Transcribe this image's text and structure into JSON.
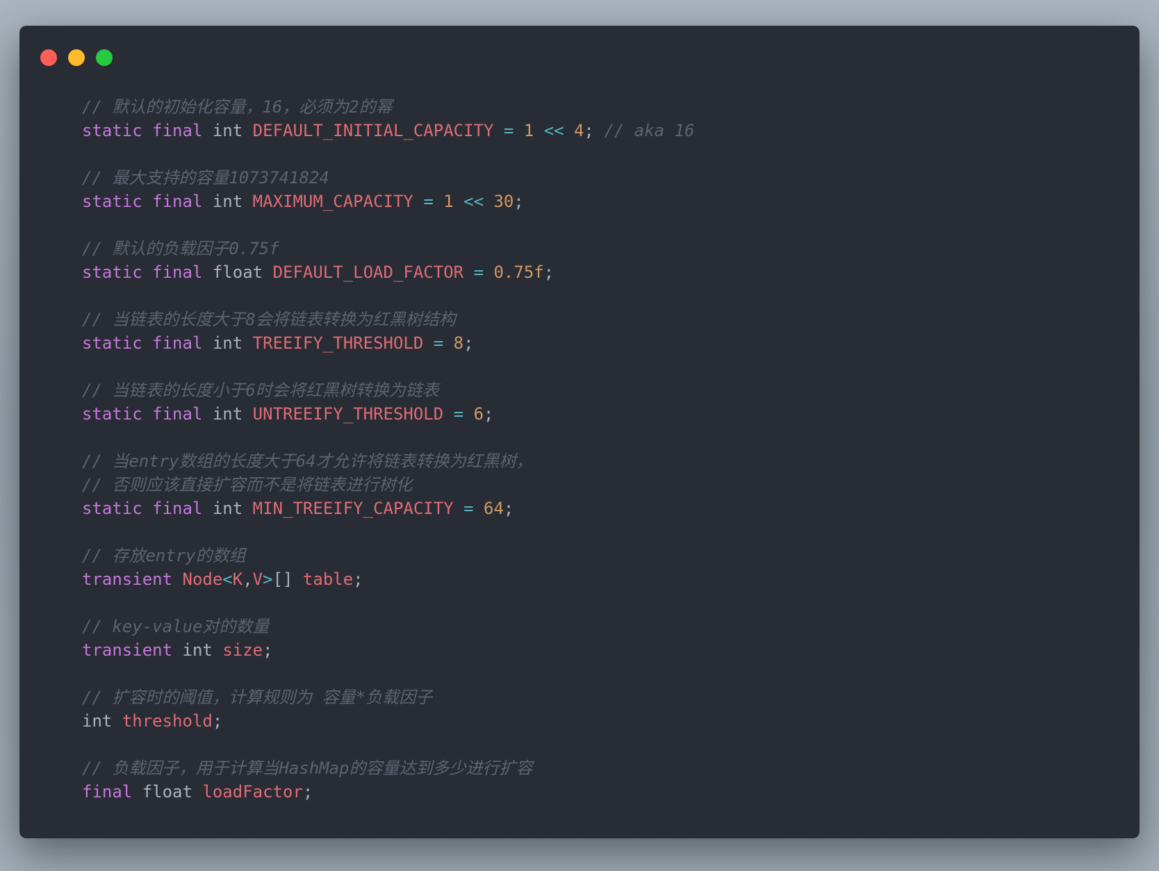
{
  "window": {
    "controls": [
      "close",
      "minimize",
      "maximize"
    ],
    "colors": {
      "background": "#282c34",
      "close": "#ff5f56",
      "minimize": "#ffbd2e",
      "maximize": "#27c93f",
      "comment": "#5c6370",
      "keyword": "#c678dd",
      "constant": "#e06c75",
      "operator": "#56b6c2",
      "number": "#d19a66",
      "plain": "#abb2bf"
    }
  },
  "code": {
    "language": "java",
    "lines": [
      {
        "tokens": [
          {
            "t": "// 默认的初始化容量，16，必须为2的幂",
            "k": "comment"
          }
        ]
      },
      {
        "tokens": [
          {
            "t": "static",
            "k": "keyword"
          },
          {
            "t": " ",
            "k": "punc"
          },
          {
            "t": "final",
            "k": "keyword"
          },
          {
            "t": " ",
            "k": "punc"
          },
          {
            "t": "int",
            "k": "type"
          },
          {
            "t": " ",
            "k": "punc"
          },
          {
            "t": "DEFAULT_INITIAL_CAPACITY",
            "k": "const"
          },
          {
            "t": " ",
            "k": "punc"
          },
          {
            "t": "=",
            "k": "op"
          },
          {
            "t": " ",
            "k": "punc"
          },
          {
            "t": "1",
            "k": "num"
          },
          {
            "t": " ",
            "k": "punc"
          },
          {
            "t": "<<",
            "k": "op"
          },
          {
            "t": " ",
            "k": "punc"
          },
          {
            "t": "4",
            "k": "num"
          },
          {
            "t": "; ",
            "k": "punc"
          },
          {
            "t": "// aka 16",
            "k": "comment"
          }
        ]
      },
      {
        "tokens": []
      },
      {
        "tokens": [
          {
            "t": "// 最大支持的容量1073741824",
            "k": "comment"
          }
        ]
      },
      {
        "tokens": [
          {
            "t": "static",
            "k": "keyword"
          },
          {
            "t": " ",
            "k": "punc"
          },
          {
            "t": "final",
            "k": "keyword"
          },
          {
            "t": " ",
            "k": "punc"
          },
          {
            "t": "int",
            "k": "type"
          },
          {
            "t": " ",
            "k": "punc"
          },
          {
            "t": "MAXIMUM_CAPACITY",
            "k": "const"
          },
          {
            "t": " ",
            "k": "punc"
          },
          {
            "t": "=",
            "k": "op"
          },
          {
            "t": " ",
            "k": "punc"
          },
          {
            "t": "1",
            "k": "num"
          },
          {
            "t": " ",
            "k": "punc"
          },
          {
            "t": "<<",
            "k": "op"
          },
          {
            "t": " ",
            "k": "punc"
          },
          {
            "t": "30",
            "k": "num"
          },
          {
            "t": ";",
            "k": "punc"
          }
        ]
      },
      {
        "tokens": []
      },
      {
        "tokens": [
          {
            "t": "// 默认的负载因子0.75f",
            "k": "comment"
          }
        ]
      },
      {
        "tokens": [
          {
            "t": "static",
            "k": "keyword"
          },
          {
            "t": " ",
            "k": "punc"
          },
          {
            "t": "final",
            "k": "keyword"
          },
          {
            "t": " ",
            "k": "punc"
          },
          {
            "t": "float",
            "k": "type"
          },
          {
            "t": " ",
            "k": "punc"
          },
          {
            "t": "DEFAULT_LOAD_FACTOR",
            "k": "const"
          },
          {
            "t": " ",
            "k": "punc"
          },
          {
            "t": "=",
            "k": "op"
          },
          {
            "t": " ",
            "k": "punc"
          },
          {
            "t": "0.75f",
            "k": "num"
          },
          {
            "t": ";",
            "k": "punc"
          }
        ]
      },
      {
        "tokens": []
      },
      {
        "tokens": [
          {
            "t": "// 当链表的长度大于8会将链表转换为红黑树结构",
            "k": "comment"
          }
        ]
      },
      {
        "tokens": [
          {
            "t": "static",
            "k": "keyword"
          },
          {
            "t": " ",
            "k": "punc"
          },
          {
            "t": "final",
            "k": "keyword"
          },
          {
            "t": " ",
            "k": "punc"
          },
          {
            "t": "int",
            "k": "type"
          },
          {
            "t": " ",
            "k": "punc"
          },
          {
            "t": "TREEIFY_THRESHOLD",
            "k": "const"
          },
          {
            "t": " ",
            "k": "punc"
          },
          {
            "t": "=",
            "k": "op"
          },
          {
            "t": " ",
            "k": "punc"
          },
          {
            "t": "8",
            "k": "num"
          },
          {
            "t": ";",
            "k": "punc"
          }
        ]
      },
      {
        "tokens": []
      },
      {
        "tokens": [
          {
            "t": "// 当链表的长度小于6时会将红黑树转换为链表",
            "k": "comment"
          }
        ]
      },
      {
        "tokens": [
          {
            "t": "static",
            "k": "keyword"
          },
          {
            "t": " ",
            "k": "punc"
          },
          {
            "t": "final",
            "k": "keyword"
          },
          {
            "t": " ",
            "k": "punc"
          },
          {
            "t": "int",
            "k": "type"
          },
          {
            "t": " ",
            "k": "punc"
          },
          {
            "t": "UNTREEIFY_THRESHOLD",
            "k": "const"
          },
          {
            "t": " ",
            "k": "punc"
          },
          {
            "t": "=",
            "k": "op"
          },
          {
            "t": " ",
            "k": "punc"
          },
          {
            "t": "6",
            "k": "num"
          },
          {
            "t": ";",
            "k": "punc"
          }
        ]
      },
      {
        "tokens": []
      },
      {
        "tokens": [
          {
            "t": "// 当entry数组的长度大于64才允许将链表转换为红黑树，",
            "k": "comment"
          }
        ]
      },
      {
        "tokens": [
          {
            "t": "// 否则应该直接扩容而不是将链表进行树化",
            "k": "comment"
          }
        ]
      },
      {
        "tokens": [
          {
            "t": "static",
            "k": "keyword"
          },
          {
            "t": " ",
            "k": "punc"
          },
          {
            "t": "final",
            "k": "keyword"
          },
          {
            "t": " ",
            "k": "punc"
          },
          {
            "t": "int",
            "k": "type"
          },
          {
            "t": " ",
            "k": "punc"
          },
          {
            "t": "MIN_TREEIFY_CAPACITY",
            "k": "const"
          },
          {
            "t": " ",
            "k": "punc"
          },
          {
            "t": "=",
            "k": "op"
          },
          {
            "t": " ",
            "k": "punc"
          },
          {
            "t": "64",
            "k": "num"
          },
          {
            "t": ";",
            "k": "punc"
          }
        ]
      },
      {
        "tokens": []
      },
      {
        "tokens": [
          {
            "t": "// 存放entry的数组",
            "k": "comment"
          }
        ]
      },
      {
        "tokens": [
          {
            "t": "transient",
            "k": "keyword"
          },
          {
            "t": " ",
            "k": "punc"
          },
          {
            "t": "Node",
            "k": "class"
          },
          {
            "t": "<",
            "k": "op"
          },
          {
            "t": "K",
            "k": "class"
          },
          {
            "t": ",",
            "k": "punc"
          },
          {
            "t": "V",
            "k": "class"
          },
          {
            "t": ">",
            "k": "op"
          },
          {
            "t": "[] ",
            "k": "punc"
          },
          {
            "t": "table",
            "k": "var"
          },
          {
            "t": ";",
            "k": "punc"
          }
        ]
      },
      {
        "tokens": []
      },
      {
        "tokens": [
          {
            "t": "// key-value对的数量",
            "k": "comment"
          }
        ]
      },
      {
        "tokens": [
          {
            "t": "transient",
            "k": "keyword"
          },
          {
            "t": " ",
            "k": "punc"
          },
          {
            "t": "int",
            "k": "type"
          },
          {
            "t": " ",
            "k": "punc"
          },
          {
            "t": "size",
            "k": "var"
          },
          {
            "t": ";",
            "k": "punc"
          }
        ]
      },
      {
        "tokens": []
      },
      {
        "tokens": [
          {
            "t": "// 扩容时的阈值，计算规则为 容量*负载因子",
            "k": "comment"
          }
        ]
      },
      {
        "tokens": [
          {
            "t": "int",
            "k": "type"
          },
          {
            "t": " ",
            "k": "punc"
          },
          {
            "t": "threshold",
            "k": "var"
          },
          {
            "t": ";",
            "k": "punc"
          }
        ]
      },
      {
        "tokens": []
      },
      {
        "tokens": [
          {
            "t": "// 负载因子，用于计算当HashMap的容量达到多少进行扩容",
            "k": "comment"
          }
        ]
      },
      {
        "tokens": [
          {
            "t": "final",
            "k": "keyword"
          },
          {
            "t": " ",
            "k": "punc"
          },
          {
            "t": "float",
            "k": "type"
          },
          {
            "t": " ",
            "k": "punc"
          },
          {
            "t": "loadFactor",
            "k": "var"
          },
          {
            "t": ";",
            "k": "punc"
          }
        ]
      }
    ]
  }
}
